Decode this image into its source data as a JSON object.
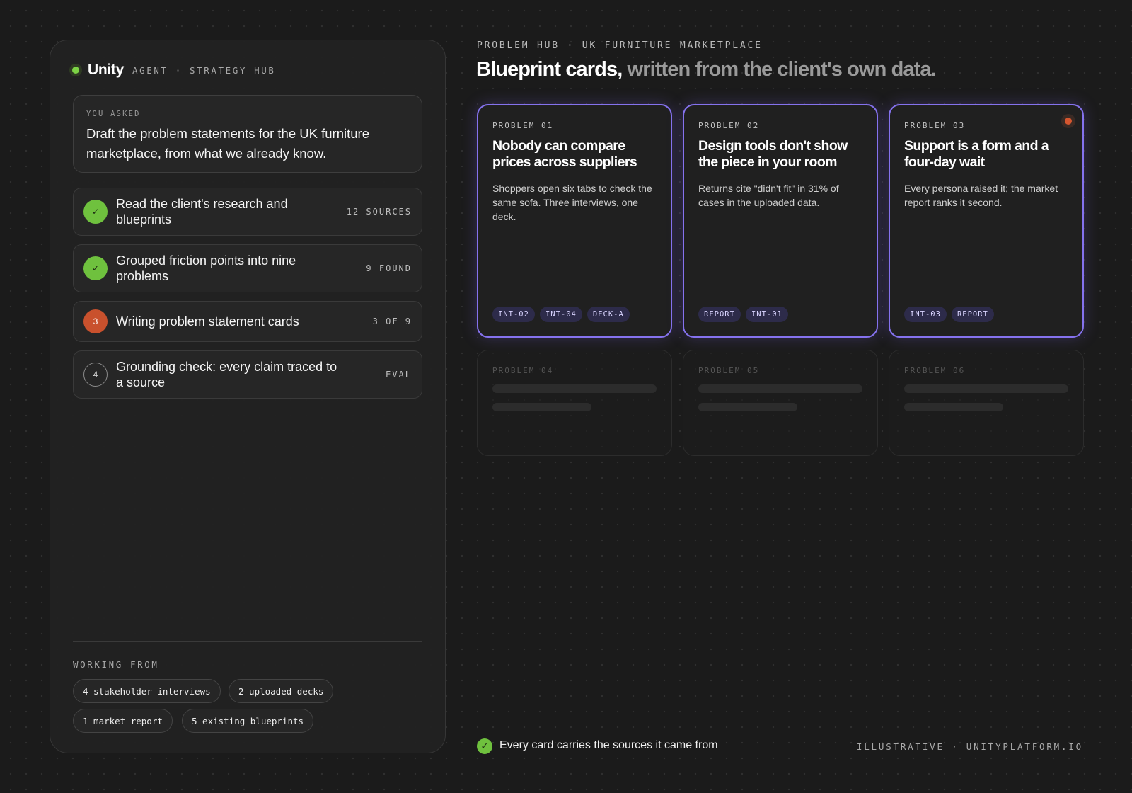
{
  "brand": {
    "name": "Unity",
    "subtitle": "AGENT · STRATEGY HUB"
  },
  "prompt": {
    "label": "YOU ASKED",
    "text": "Draft the problem statements for the UK furniture marketplace, from what we already know."
  },
  "steps": [
    {
      "number": "1",
      "status": "done",
      "icon": "check-icon",
      "title": "Read the client's research and blueprints",
      "meta": "12 SOURCES"
    },
    {
      "number": "2",
      "status": "done",
      "icon": "check-icon",
      "title": "Grouped friction points into nine problems",
      "meta": "9 FOUND"
    },
    {
      "number": "3",
      "status": "active",
      "icon": "",
      "title": "Writing problem statement cards",
      "meta": "3 OF 9"
    },
    {
      "number": "4",
      "status": "pending",
      "icon": "",
      "title": "Grounding check: every claim traced to a source",
      "meta": "EVAL"
    }
  ],
  "working_from": {
    "label": "WORKING FROM",
    "chips": [
      "4 stakeholder interviews",
      "2 uploaded decks",
      "1 market report",
      "5 existing blueprints"
    ]
  },
  "header": {
    "eyebrow": "PROBLEM HUB · UK FURNITURE MARKETPLACE",
    "title_strong": "Blueprint cards,",
    "title_muted": "written from the client's own data."
  },
  "cards": [
    {
      "label": "PROBLEM 01",
      "title": "Nobody can compare prices across suppliers",
      "body": "Shoppers open six tabs to check the same sofa. Three interviews, one deck.",
      "tags": [
        "INT-02",
        "INT-04",
        "DECK-A"
      ],
      "flagged": false
    },
    {
      "label": "PROBLEM 02",
      "title": "Design tools don't show the piece in your room",
      "body": "Returns cite \"didn't fit\" in 31% of cases in the uploaded data.",
      "tags": [
        "REPORT",
        "INT-01"
      ],
      "flagged": false
    },
    {
      "label": "PROBLEM 03",
      "title": "Support is a form and a four-day wait",
      "body": "Every persona raised it; the market report ranks it second.",
      "tags": [
        "INT-03",
        "REPORT"
      ],
      "flagged": true
    }
  ],
  "pending_cards": [
    {
      "label": "PROBLEM 04"
    },
    {
      "label": "PROBLEM 05"
    },
    {
      "label": "PROBLEM 06"
    }
  ],
  "footer": {
    "note": "Every card carries the sources it came from",
    "right": "ILLUSTRATIVE · UNITYPLATFORM.IO",
    "check_icon": "✓"
  },
  "colors": {
    "accent_purple": "#8572ee",
    "success_green": "#6fc13e",
    "active_orange": "#c9512d",
    "background": "#1b1b1b"
  }
}
